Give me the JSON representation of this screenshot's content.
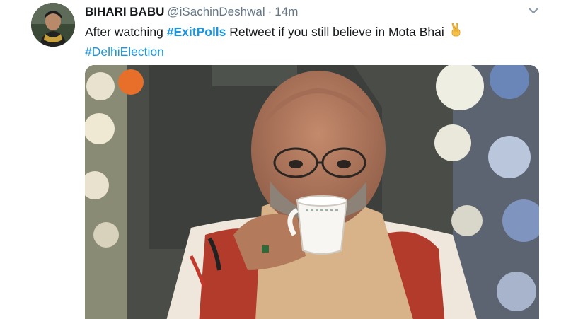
{
  "tweet": {
    "display_name": "BIHARI BABU",
    "handle": "@iSachinDeshwal",
    "separator": "·",
    "time": "14m",
    "text_prefix": "After watching ",
    "hashtag_1": "#ExitPolls",
    "text_middle": " Retweet if you still believe in Mota Bhai",
    "emoji": "victory-hand",
    "hashtag_2": "#DelhiElection",
    "media": {
      "type": "photo",
      "subject": "man in glasses sipping from a white teacup"
    }
  },
  "colors": {
    "link": "#1b95e0",
    "text": "#14171a",
    "secondary": "#657786"
  }
}
